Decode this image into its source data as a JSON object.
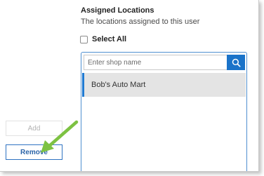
{
  "assigned_locations": {
    "title": "Assigned Locations",
    "subtitle": "The locations assigned to this user",
    "select_all_label": "Select All",
    "select_all_checked": false,
    "search": {
      "placeholder": "Enter shop name",
      "value": "",
      "button_icon": "search-icon"
    },
    "items": [
      {
        "label": "Bob's Auto Mart",
        "selected": true
      }
    ]
  },
  "actions": {
    "add_label": "Add",
    "add_enabled": false,
    "remove_label": "Remove"
  },
  "annotation": {
    "icon": "arrow-icon",
    "color": "#7dc242"
  },
  "colors": {
    "accent": "#1a73c9",
    "selection_bar": "#1f7ad3",
    "selected_row_bg": "#e4e4e4"
  }
}
